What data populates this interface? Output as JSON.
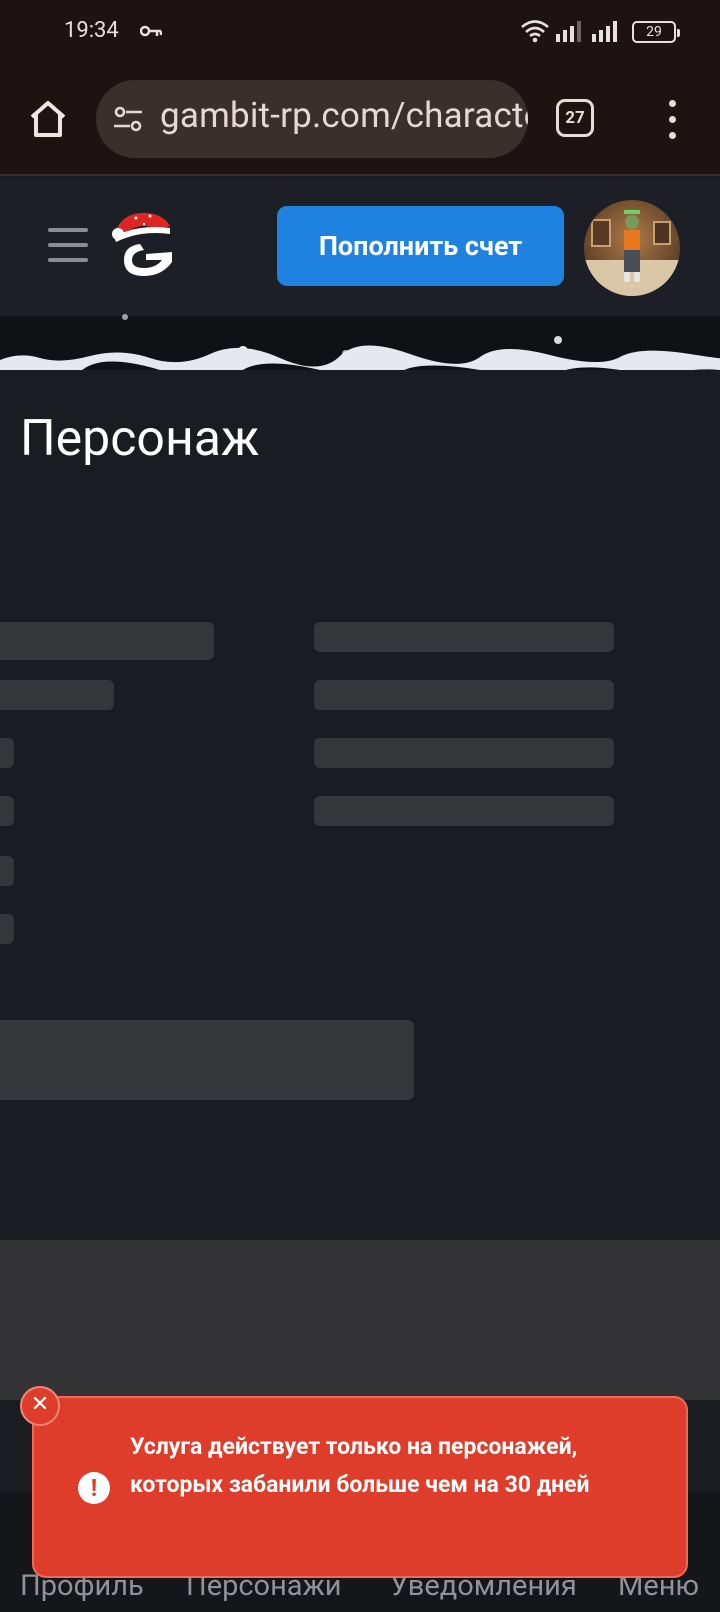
{
  "status_bar": {
    "time": "19:34",
    "battery": "29"
  },
  "browser": {
    "url": "gambit-rp.com/characters",
    "tab_count": "27"
  },
  "header": {
    "topup_label": "Пополнить счет"
  },
  "page": {
    "title": "Персонаж"
  },
  "bottom_nav": {
    "items": [
      "Профиль",
      "Персонажи",
      "Уведомления",
      "Меню"
    ]
  },
  "toast": {
    "message": "Услуга действует только на персонажей, которых забанили больше чем на 30 дней",
    "color": "#dd3d2a"
  },
  "colors": {
    "accent": "#1f82e0",
    "background": "#1b1c21"
  }
}
